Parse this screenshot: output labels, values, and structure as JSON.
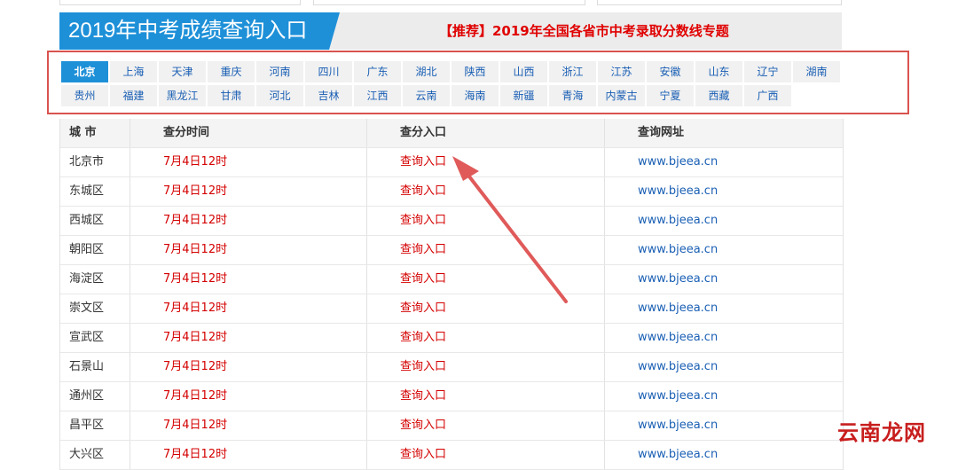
{
  "header": {
    "title": "2019年中考成绩查询入口",
    "recommend": "【推荐】2019年全国各省市中考录取分数线专题"
  },
  "provinces": {
    "active": "北京",
    "items": [
      "北京",
      "上海",
      "天津",
      "重庆",
      "河南",
      "四川",
      "广东",
      "湖北",
      "陕西",
      "山西",
      "浙江",
      "江苏",
      "安徽",
      "山东",
      "辽宁",
      "湖南",
      "贵州",
      "福建",
      "黑龙江",
      "甘肃",
      "河北",
      "吉林",
      "江西",
      "云南",
      "海南",
      "新疆",
      "青海",
      "内蒙古",
      "宁夏",
      "西藏",
      "广西"
    ]
  },
  "table": {
    "headers": [
      "城 市",
      "查分时间",
      "查分入口",
      "查询网址"
    ],
    "rows": [
      {
        "city": "北京市",
        "time": "7月4日12时",
        "entry": "查询入口",
        "url": "www.bjeea.cn"
      },
      {
        "city": "东城区",
        "time": "7月4日12时",
        "entry": "查询入口",
        "url": "www.bjeea.cn"
      },
      {
        "city": "西城区",
        "time": "7月4日12时",
        "entry": "查询入口",
        "url": "www.bjeea.cn"
      },
      {
        "city": "朝阳区",
        "time": "7月4日12时",
        "entry": "查询入口",
        "url": "www.bjeea.cn"
      },
      {
        "city": "海淀区",
        "time": "7月4日12时",
        "entry": "查询入口",
        "url": "www.bjeea.cn"
      },
      {
        "city": "崇文区",
        "time": "7月4日12时",
        "entry": "查询入口",
        "url": "www.bjeea.cn"
      },
      {
        "city": "宣武区",
        "time": "7月4日12时",
        "entry": "查询入口",
        "url": "www.bjeea.cn"
      },
      {
        "city": "石景山",
        "time": "7月4日12时",
        "entry": "查询入口",
        "url": "www.bjeea.cn"
      },
      {
        "city": "通州区",
        "time": "7月4日12时",
        "entry": "查询入口",
        "url": "www.bjeea.cn"
      },
      {
        "city": "昌平区",
        "time": "7月4日12时",
        "entry": "查询入口",
        "url": "www.bjeea.cn"
      },
      {
        "city": "大兴区",
        "time": "7月4日12时",
        "entry": "查询入口",
        "url": "www.bjeea.cn"
      }
    ]
  },
  "watermark": "云南龙网",
  "colors": {
    "accent": "#1e90d8",
    "highlight": "#d9534f",
    "link": "#1a5fb4",
    "red_text": "#d40000"
  }
}
